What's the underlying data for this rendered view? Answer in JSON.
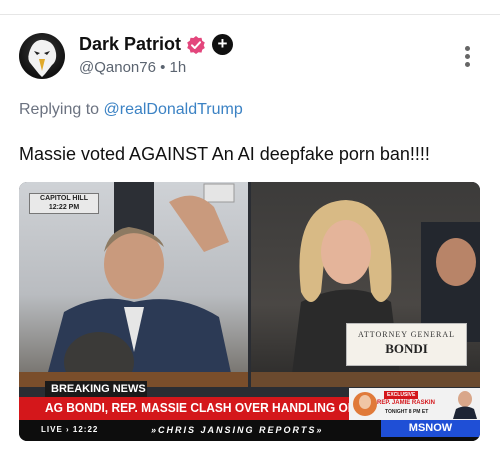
{
  "post": {
    "author_name": "Dark Patriot",
    "handle_line": "@Qanon76 • 1h",
    "plus_badge": "+",
    "reply_prefix": "Replying to ",
    "reply_mention": "@realDonaldTrump",
    "body_text": "Massie voted AGAINST An AI deepfake porn ban!!!!",
    "icons": {
      "avatar": "eagle-avatar",
      "verified": "verified-badge-icon",
      "more": "more-vertical-icon"
    },
    "colors": {
      "verified": "#e3467c",
      "mention": "#3b82c4",
      "news_red": "#d4171b",
      "msnow_blue": "#1f4fd6"
    }
  },
  "media": {
    "capitol_label": "CAPITOL HILL\n12:22 PM",
    "nameplate_title": "ATTORNEY GENERAL",
    "nameplate_name": "BONDI",
    "breaking_label": "BREAKING NEWS",
    "headline": "AG BONDI, REP. MASSIE CLASH OVER HANDLING OF EPSTEIN FILES",
    "promo_exclusive": "EXCLUSIVE",
    "promo_name": "REP. JAMIE RASKIN",
    "promo_time": "TONIGHT 8 PM ET",
    "live_text": "LIVE › 12:22",
    "show_text": "»CHRIS JANSING REPORTS»",
    "network": "MSNOW"
  }
}
